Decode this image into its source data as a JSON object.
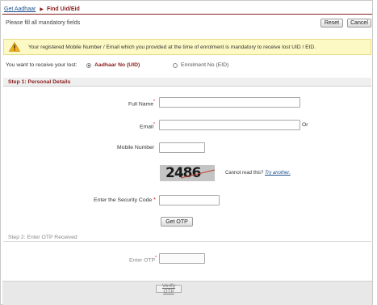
{
  "breadcrumb": {
    "parent": "Get Aadhaar",
    "current": "Find Uid/Eid"
  },
  "toolbar": {
    "mandatory_note": "Please fill all mandatory fields",
    "reset_label": "Reset",
    "cancel_label": "Cancel"
  },
  "notice": {
    "text": "Your registered Mobile Number / Email which you provided at the time of enrolment is mandatory to receive lost UID / EID."
  },
  "receive": {
    "label": "You want to receive your lost:",
    "options": [
      {
        "label": "Aadhaar No (UID)",
        "selected": true
      },
      {
        "label": "Enrolment No (EID)",
        "selected": false
      }
    ]
  },
  "step1": {
    "title": "Step 1: Personal Details",
    "full_name_label": "Full Name",
    "email_label": "Email",
    "or_text": "Or",
    "mobile_label": "Mobile Number",
    "full_name_value": "",
    "email_value": "",
    "mobile_value": "",
    "captcha_text": "2486",
    "cant_read_text": "Cannot read this?",
    "try_another_label": "Try another.",
    "security_label": "Enter the Security Code",
    "security_value": "",
    "get_otp_label": "Get OTP"
  },
  "step2": {
    "title": "Step 2: Enter OTP Received",
    "otp_label": "Enter OTP",
    "otp_value": ""
  },
  "footer": {
    "verify_label": "Verify OTP"
  },
  "colors": {
    "accent": "#8a1c1c",
    "link": "#1a4f8e",
    "notice_bg": "#fdf9c4",
    "required": "#cc0000"
  }
}
